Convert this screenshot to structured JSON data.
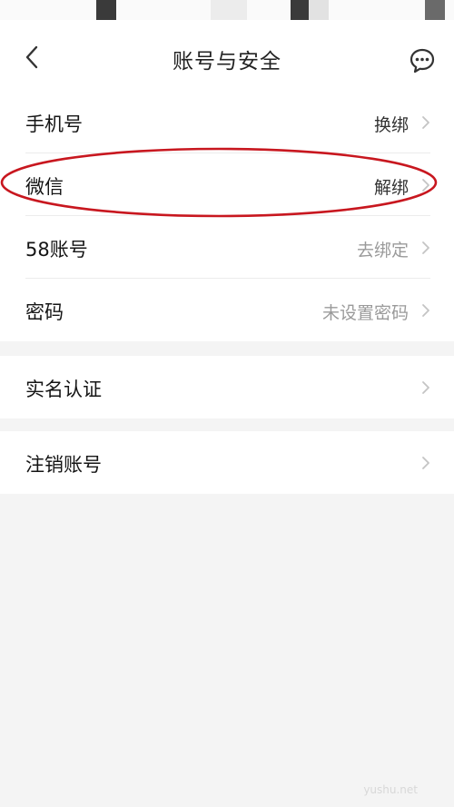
{
  "nav": {
    "title": "账号与安全",
    "back_icon": "chevron-left-icon",
    "message_icon": "chat-bubble-icon"
  },
  "account_group": [
    {
      "id": "phone",
      "label": "手机号",
      "value": "换绑",
      "value_muted": false
    },
    {
      "id": "wechat",
      "label": "微信",
      "value": "解绑",
      "value_muted": false
    },
    {
      "id": "58-account",
      "label": "58账号",
      "value": "去绑定",
      "value_muted": true
    },
    {
      "id": "password",
      "label": "密码",
      "value": "未设置密码",
      "value_muted": true
    }
  ],
  "verify_group": [
    {
      "id": "real-name",
      "label": "实名认证"
    }
  ],
  "cancel_group": [
    {
      "id": "cancel-account",
      "label": "注销账号"
    }
  ],
  "highlight": {
    "color": "#c8171f",
    "target": "wechat"
  },
  "watermark": "yushu.net",
  "colors": {
    "page_bg": "#f4f4f4",
    "card_bg": "#ffffff",
    "muted_text": "#9a9a9a",
    "chevron": "#c4c4c4"
  }
}
